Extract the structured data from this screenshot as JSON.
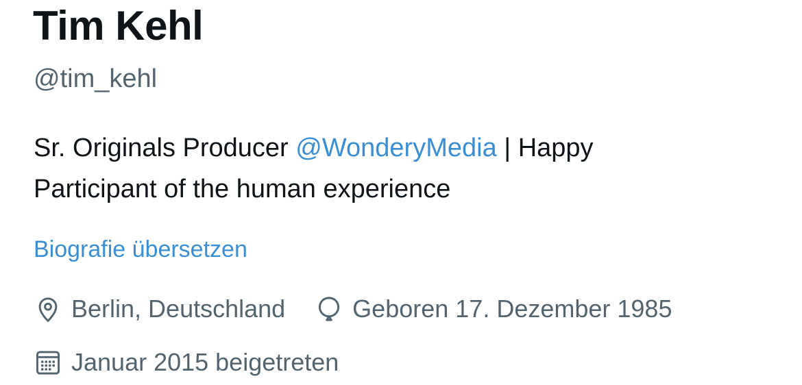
{
  "profile": {
    "display_name": "Tim Kehl",
    "handle": "@tim_kehl",
    "bio": {
      "line1_prefix": "Sr. Originals Producer ",
      "mention": "@WonderyMedia",
      "line1_suffix": " | Happy",
      "line2": "Participant of the human experience"
    },
    "translate_label": "Biografie übersetzen",
    "meta": {
      "location": {
        "icon": "location-pin-icon",
        "text": "Berlin, Deutschland"
      },
      "birthday": {
        "icon": "balloon-icon",
        "text": "Geboren 17. Dezember 1985"
      },
      "joined": {
        "icon": "calendar-icon",
        "text": "Januar 2015 beigetreten"
      }
    }
  },
  "colors": {
    "text_primary": "#0f1419",
    "text_secondary": "#536471",
    "link": "#3a8fd4"
  }
}
